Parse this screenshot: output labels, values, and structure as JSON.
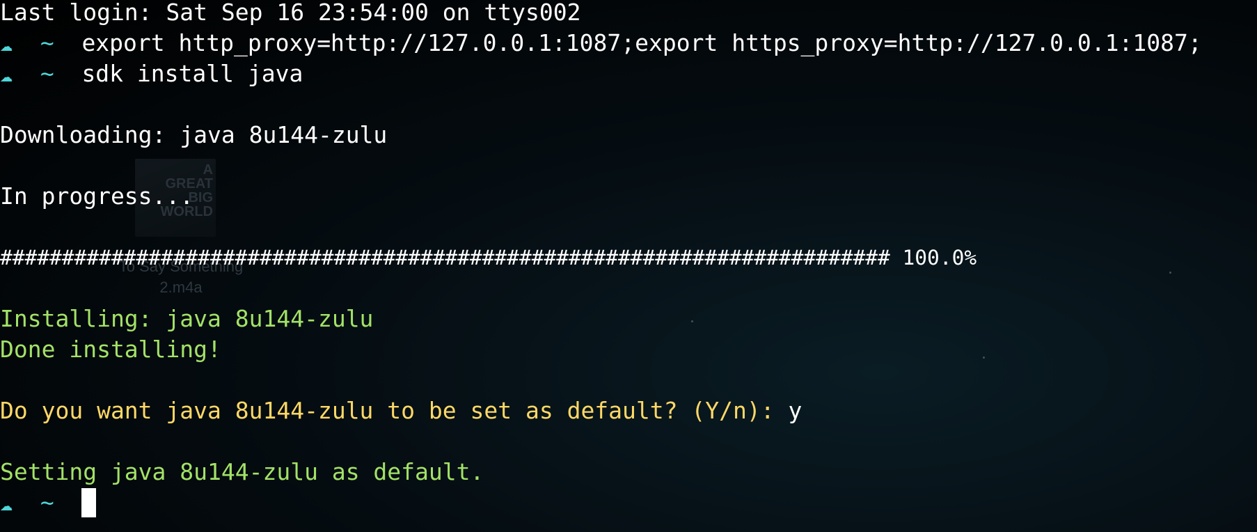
{
  "terminal": {
    "background_color": "#000000",
    "text_color": "#ffffff",
    "prompt_color": "#4fd6d9",
    "success_color": "#a3e267",
    "question_color": "#ffd866",
    "last_login": "Last login: Sat Sep 16 23:54:00 on ttys002",
    "prompt_icon": "cloud-icon",
    "prompt_symbol": "~",
    "cmd1": "export http_proxy=http://127.0.0.1:1087;export https_proxy=http://127.0.0.1:1087;",
    "cmd2": "sdk install java",
    "downloading": "Downloading: java 8u144-zulu",
    "in_progress": "In progress...",
    "progress_bar": "########################################################################",
    "progress_percent": "100.0%",
    "progress_value": 1.0,
    "installing": "Installing: java 8u144-zulu",
    "done_installing": "Done installing!",
    "default_question": "Do you want java 8u144-zulu to be set as default? (Y/n): ",
    "default_answer": "y",
    "setting_default": "Setting java 8u144-zulu as default."
  },
  "desktop": {
    "icon_art_text": "A\nGREAT\nBIG\nWORLD",
    "icon_label": "To Say Something\n2.m4a"
  }
}
